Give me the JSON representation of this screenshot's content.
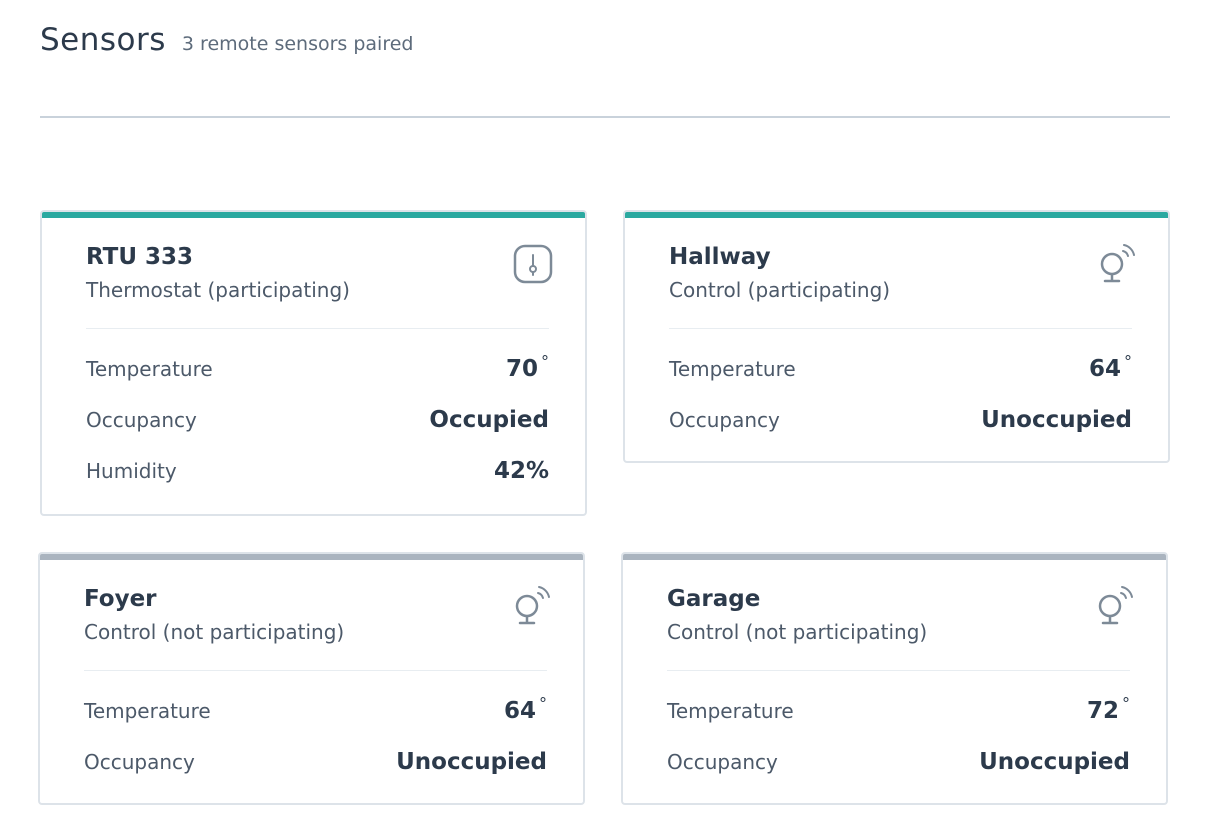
{
  "header": {
    "title": "Sensors",
    "subtitle": "3 remote sensors paired"
  },
  "colors": {
    "participating": "#2ba9a0",
    "not_participating": "#aab4bf"
  },
  "sensors": [
    {
      "name": "RTU 333",
      "role": "Thermostat (participating)",
      "icon": "thermostat-icon",
      "rows": [
        {
          "label": "Temperature",
          "value": "70",
          "unit": "°"
        },
        {
          "label": "Occupancy",
          "value": "Occupied"
        },
        {
          "label": "Humidity",
          "value": "42%"
        }
      ]
    },
    {
      "name": "Hallway",
      "role": "Control (participating)",
      "icon": "remote-sensor-icon",
      "rows": [
        {
          "label": "Temperature",
          "value": "64",
          "unit": "°"
        },
        {
          "label": "Occupancy",
          "value": "Unoccupied"
        }
      ]
    },
    {
      "name": "Foyer",
      "role": "Control (not participating)",
      "icon": "remote-sensor-icon",
      "rows": [
        {
          "label": "Temperature",
          "value": "64",
          "unit": "°"
        },
        {
          "label": "Occupancy",
          "value": "Unoccupied"
        }
      ]
    },
    {
      "name": "Garage",
      "role": "Control (not participating)",
      "icon": "remote-sensor-icon",
      "rows": [
        {
          "label": "Temperature",
          "value": "72",
          "unit": "°"
        },
        {
          "label": "Occupancy",
          "value": "Unoccupied"
        }
      ]
    }
  ]
}
